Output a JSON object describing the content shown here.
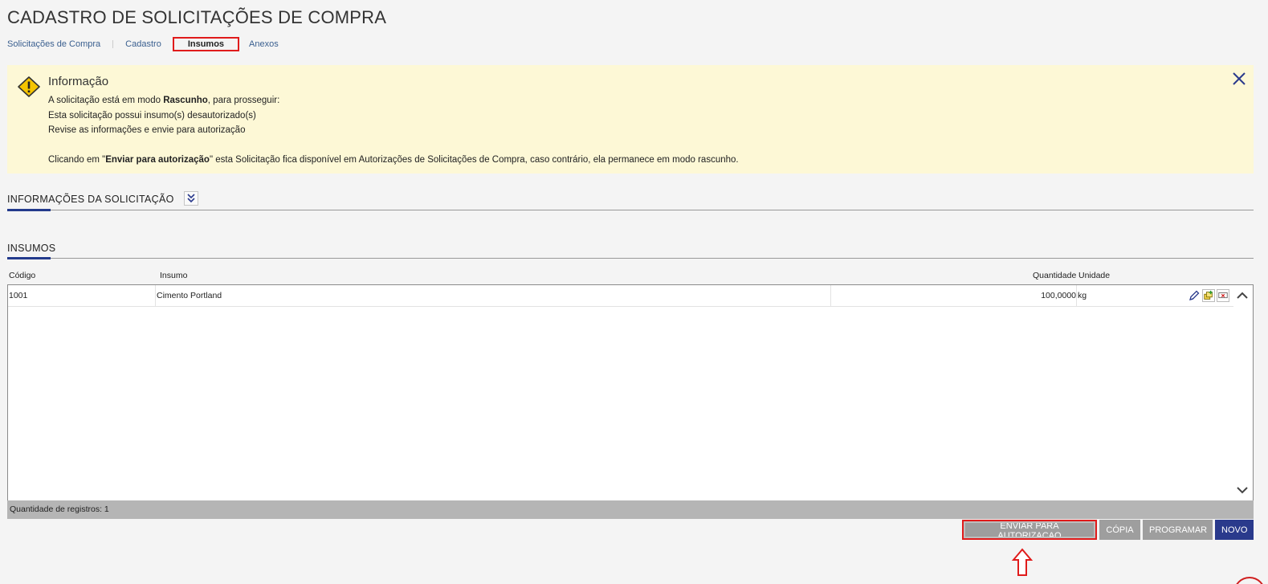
{
  "page": {
    "title": "CADASTRO DE SOLICITAÇÕES DE COMPRA"
  },
  "breadcrumb": [
    {
      "label": "Solicitações de Compra"
    },
    {
      "label": "Cadastro"
    },
    {
      "label": "Insumos"
    },
    {
      "label": "Anexos"
    }
  ],
  "info": {
    "title": "Informação",
    "line1_pre": "A solicitação está em modo ",
    "line1_bold": "Rascunho",
    "line1_post": ", para prosseguir:",
    "line2": "Esta solicitação possui insumo(s) desautorizado(s)",
    "line3": "Revise as informações e envie para autorização",
    "line4_pre": "Clicando em \"",
    "line4_bold": "Enviar para autorização",
    "line4_post": "\" esta Solicitação fica disponível em Autorizações de Solicitações de Compra, caso contrário, ela permanece em modo rascunho.",
    "icon": "warning-icon",
    "close_icon": "close-icon"
  },
  "sections": {
    "info_label": "INFORMAÇÕES DA SOLICITAÇÃO",
    "insumos_label": "INSUMOS"
  },
  "table": {
    "headers": {
      "codigo": "Código",
      "insumo": "Insumo",
      "quantidade": "Quantidade",
      "unidade": "Unidade"
    },
    "rows": [
      {
        "codigo": "1001",
        "insumo": "Cimento Portland",
        "quantidade": "100,0000",
        "unidade": "kg"
      }
    ],
    "row_actions": [
      "edit-pencil-icon",
      "add-copy-icon",
      "remove-icon"
    ]
  },
  "footer": {
    "count": "Quantidade de registros: 1"
  },
  "buttons": {
    "enviar": "ENVIAR PARA AUTORIZACAO",
    "copia": "CÓPIA",
    "programar": "PROGRAMAR",
    "novo": "NOVO"
  },
  "colors": {
    "accent": "#2a3a8c",
    "info_bg": "#fdf8d6",
    "highlight": "#e01b1b",
    "button_gray": "#9e9e9e"
  }
}
